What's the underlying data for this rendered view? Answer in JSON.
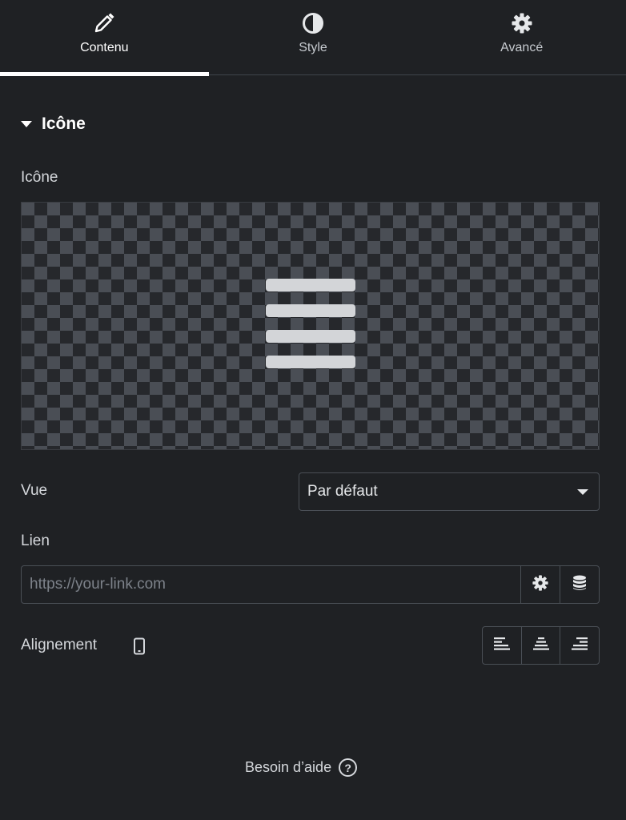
{
  "tabs": [
    {
      "label": "Contenu",
      "icon": "pencil-icon",
      "active": true
    },
    {
      "label": "Style",
      "icon": "half-circle-icon",
      "active": false
    },
    {
      "label": "Avancé",
      "icon": "gear-icon",
      "active": false
    }
  ],
  "section": {
    "title": "Icône",
    "icon": "caret-down-icon"
  },
  "icon_field": {
    "label": "Icône",
    "selected_icon": "bars-icon"
  },
  "view_field": {
    "label": "Vue",
    "value": "Par défaut"
  },
  "link_field": {
    "label": "Lien",
    "placeholder": "https://your-link.com",
    "settings_icon": "gear-icon",
    "dynamic_icon": "database-icon"
  },
  "alignment_field": {
    "label": "Alignement",
    "device_icon": "mobile-icon",
    "options": [
      "align-left-icon",
      "align-center-icon",
      "align-right-icon"
    ]
  },
  "help": {
    "label": "Besoin d’aide",
    "icon": "question-circle-icon"
  },
  "colors": {
    "background": "#1f2124",
    "text": "#d5d8dc",
    "active": "#ffffff",
    "border": "#4a4f56"
  }
}
